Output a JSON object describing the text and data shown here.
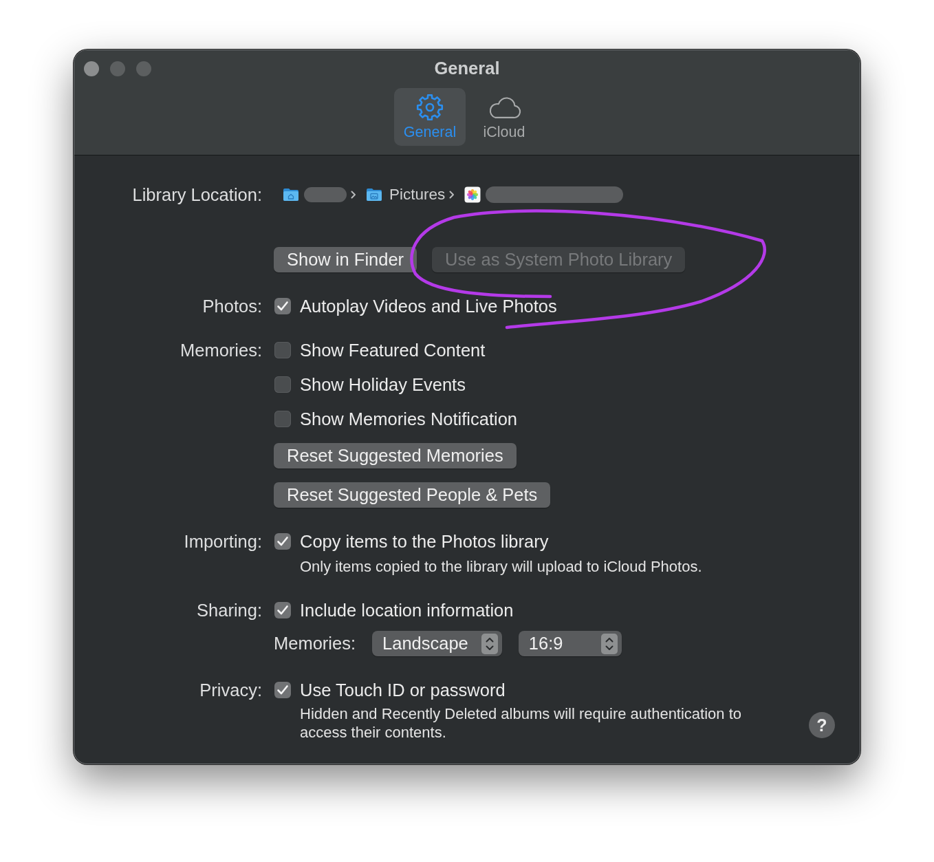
{
  "window": {
    "title": "General"
  },
  "toolbar": {
    "tabs": [
      {
        "label": "General",
        "selected": true
      },
      {
        "label": "iCloud",
        "selected": false
      }
    ]
  },
  "settings": [
    {
      "label": "Library Location:",
      "rows": [
        {
          "kind": "path",
          "items": [
            {
              "kind": "home",
              "redacted": true
            },
            {
              "kind": "folder",
              "name": "Pictures",
              "redacted": false
            },
            {
              "kind": "library",
              "redacted": true
            }
          ]
        },
        {
          "kind": "buttons",
          "buttons": [
            {
              "label": "Show in Finder",
              "disabled": false
            },
            {
              "label": "Use as System Photo Library",
              "disabled": true
            }
          ]
        }
      ]
    },
    {
      "label": "Photos:",
      "rows": [
        {
          "kind": "checkbox",
          "label": "Autoplay Videos and Live Photos",
          "checked": true
        }
      ]
    },
    {
      "label": "Memories:",
      "rows": [
        {
          "kind": "checkbox",
          "label": "Show Featured Content",
          "checked": false
        },
        {
          "kind": "checkbox",
          "label": "Show Holiday Events",
          "checked": false
        },
        {
          "kind": "checkbox",
          "label": "Show Memories Notification",
          "checked": false
        },
        {
          "kind": "buttons",
          "buttons": [
            {
              "label": "Reset Suggested Memories",
              "disabled": false
            }
          ]
        },
        {
          "kind": "buttons",
          "buttons": [
            {
              "label": "Reset Suggested People & Pets",
              "disabled": false
            }
          ]
        }
      ]
    },
    {
      "label": "Importing:",
      "rows": [
        {
          "kind": "checkbox",
          "label": "Copy items to the Photos library",
          "checked": true
        },
        {
          "kind": "note",
          "text": "Only items copied to the library will upload to iCloud Photos."
        }
      ]
    },
    {
      "label": "Sharing:",
      "rows": [
        {
          "kind": "checkbox",
          "label": "Include location information",
          "checked": true
        },
        {
          "kind": "popups",
          "label": "Memories:",
          "popups": [
            {
              "value": "Landscape"
            },
            {
              "value": "16:9"
            }
          ]
        }
      ]
    },
    {
      "label": "Privacy:",
      "rows": [
        {
          "kind": "checkbox",
          "label": "Use Touch ID or password",
          "checked": true
        },
        {
          "kind": "note",
          "text": "Hidden and Recently Deleted albums will require authentication to access their contents."
        }
      ]
    }
  ],
  "help_button": {
    "label": "?"
  },
  "annotation": {
    "kind": "loop"
  }
}
